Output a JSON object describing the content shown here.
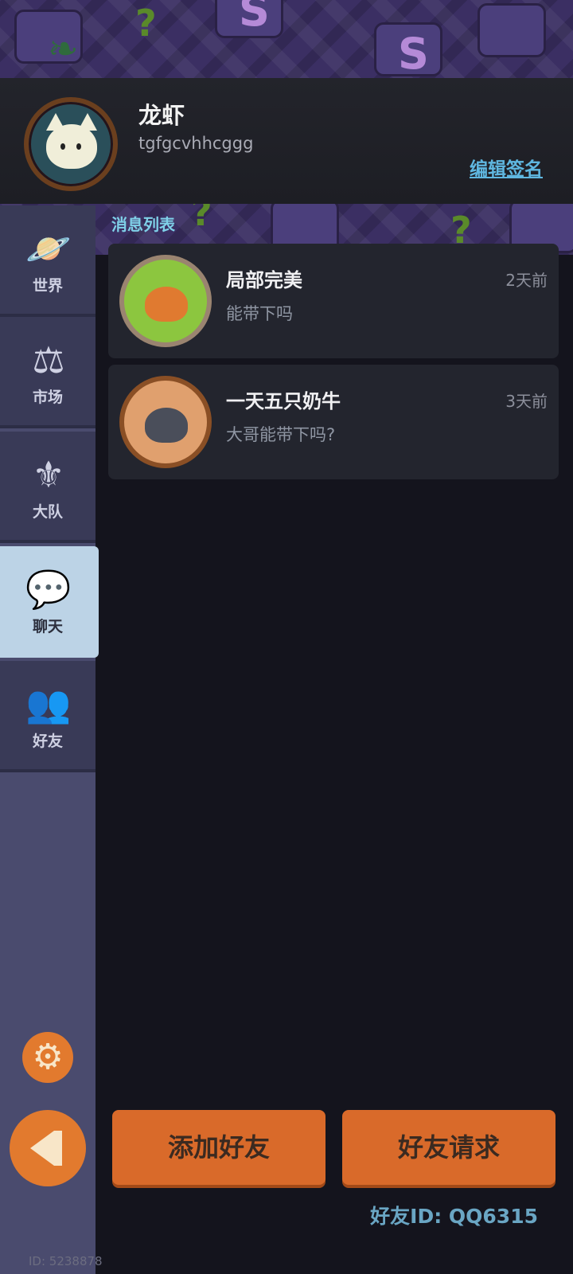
{
  "profile": {
    "name": "龙虾",
    "signature": "tgfgcvhhcggg",
    "edit_signature_label": "编辑签名"
  },
  "sidebar": {
    "items": [
      {
        "label": "世界",
        "icon": "planet-icon"
      },
      {
        "label": "市场",
        "icon": "gavel-icon"
      },
      {
        "label": "大队",
        "icon": "crest-icon"
      },
      {
        "label": "聊天",
        "icon": "chat-icon"
      },
      {
        "label": "好友",
        "icon": "friends-icon"
      }
    ],
    "active_index": 3,
    "settings_icon": "gear-icon",
    "back_icon": "back-arrow-icon",
    "user_id_text": "ID: 5238878"
  },
  "messages": {
    "section_title": "消息列表",
    "items": [
      {
        "name": "局部完美",
        "time": "2天前",
        "preview": "能带下吗"
      },
      {
        "name": "一天五只奶牛",
        "time": "3天前",
        "preview": "大哥能带下吗?"
      }
    ]
  },
  "actions": {
    "add_friend_label": "添加好友",
    "friend_requests_label": "好友请求"
  },
  "friend_id_text": "好友ID: QQ6315",
  "colors": {
    "accent_orange": "#d96a2a",
    "active_tab": "#bcd3e6",
    "link_blue": "#5fb7e0",
    "section_cyan": "#7fd0e8"
  }
}
